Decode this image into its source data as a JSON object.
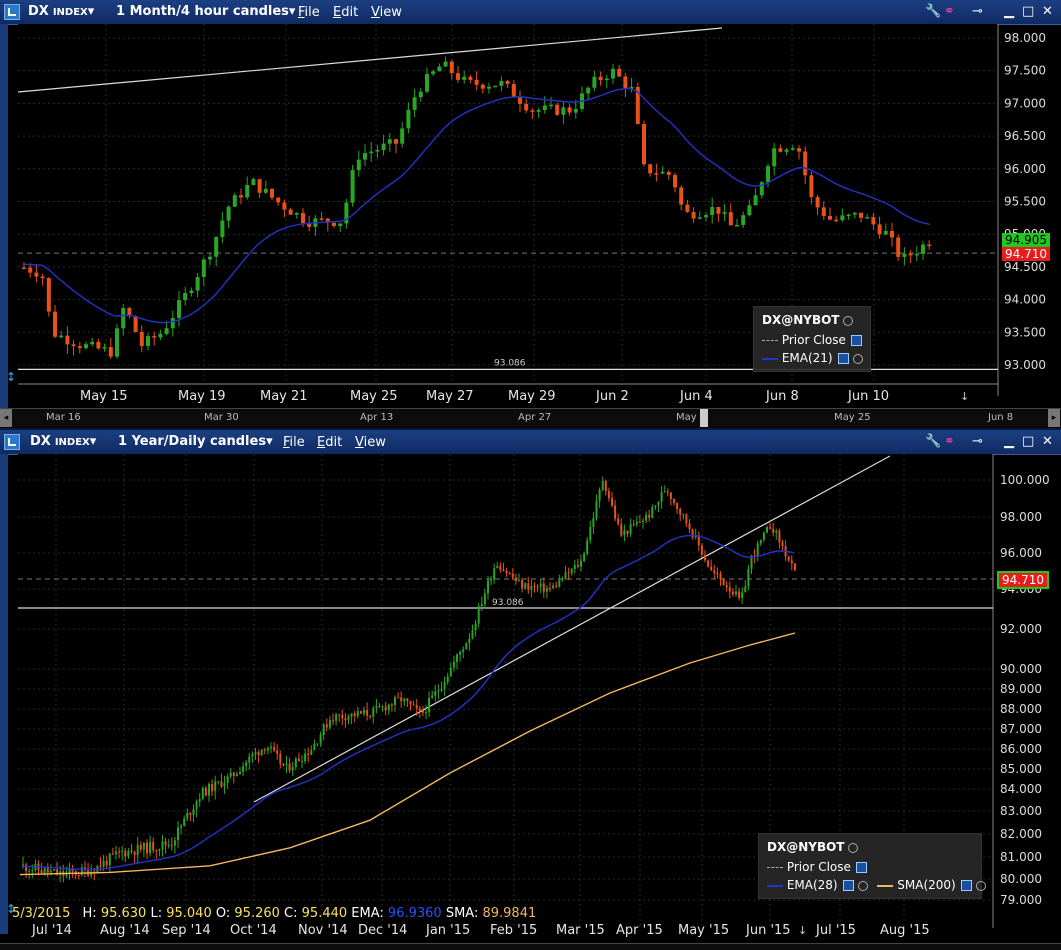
{
  "top": {
    "symbol": "DX",
    "instrument": "INDEX",
    "timeframe": "1 Month/4 hour candles",
    "menu": [
      "File",
      "Edit",
      "View"
    ],
    "yticks": [
      "98.000",
      "97.500",
      "97.000",
      "96.500",
      "96.000",
      "95.500",
      "95.000",
      "94.500",
      "94.000",
      "93.500",
      "93.000"
    ],
    "xticks": [
      "May 15",
      "May 19",
      "May 21",
      "May 25",
      "May 27",
      "May 29",
      "Jun 2",
      "Jun 4",
      "Jun 8",
      "Jun 10"
    ],
    "scroll_dates": [
      "Mar 16",
      "Mar 30",
      "Apr 13",
      "Apr 27",
      "May",
      "May 25",
      "Jun 8"
    ],
    "hline_label": "93.086",
    "last_price": "94.905",
    "prior_close": "94.710",
    "legend": {
      "title": "DX@NYBOT",
      "prior_close": "Prior Close",
      "ema": "EMA(21)"
    },
    "colors": {
      "ema": "#2034c8",
      "up": "#2aa626",
      "down": "#e8501c",
      "last_bg": "#1ec81e",
      "prior_bg": "#e81c1c"
    }
  },
  "bottom": {
    "symbol": "DX",
    "instrument": "INDEX",
    "timeframe": "1 Year/Daily candles",
    "menu": [
      "File",
      "Edit",
      "View"
    ],
    "yticks": [
      "100.000",
      "98.000",
      "96.000",
      "94.000",
      "92.000",
      "90.000",
      "89.000",
      "88.000",
      "87.000",
      "86.000",
      "85.000",
      "84.000",
      "83.000",
      "82.000",
      "81.000",
      "80.000",
      "79.000"
    ],
    "xticks": [
      "Jul '14",
      "Aug '14",
      "Sep '14",
      "Oct '14",
      "Nov '14",
      "Dec '14",
      "Jan '15",
      "Feb '15",
      "Mar '15",
      "Apr '15",
      "May '15",
      "Jun '15",
      "Jul '15",
      "Aug '15"
    ],
    "hline_label": "93.086",
    "prior_close": "94.710",
    "legend": {
      "title": "DX@NYBOT",
      "prior_close": "Prior Close",
      "ema": "EMA(28)",
      "sma": "SMA(200)"
    },
    "info": {
      "date": "5/3/2015",
      "h_label": "H:",
      "h": "95.630",
      "l_label": "L:",
      "l": "95.040",
      "o_label": "O:",
      "o": "95.260",
      "c_label": "C:",
      "c": "95.440",
      "ema_label": "EMA:",
      "ema": "96.9360",
      "sma_label": "SMA:",
      "sma": "89.9841"
    },
    "colors": {
      "ema": "#2034c8",
      "sma": "#f0b860",
      "up": "#2aa626",
      "down": "#e8501c"
    }
  }
}
